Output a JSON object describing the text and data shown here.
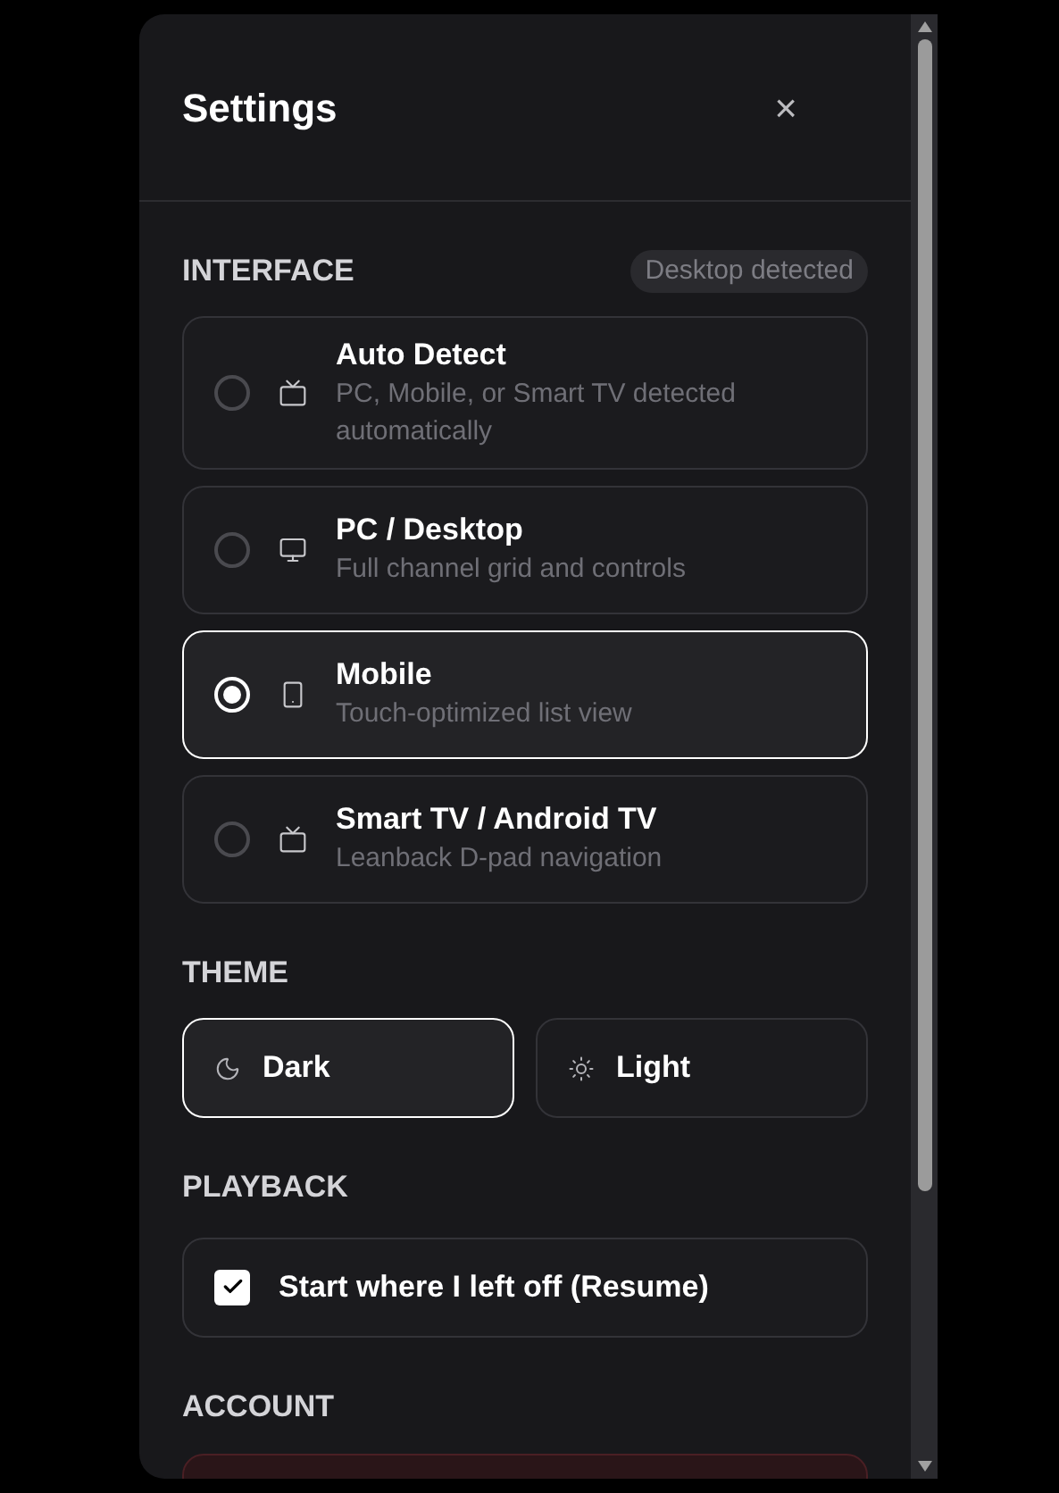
{
  "dialog": {
    "title": "Settings",
    "close": "×"
  },
  "interface": {
    "heading": "INTERFACE",
    "badge": "Desktop detected",
    "options": [
      {
        "kind": "tv",
        "title": "Auto Detect",
        "description": "PC, Mobile, or Smart TV detected automatically",
        "selected": false
      },
      {
        "kind": "monitor",
        "title": "PC / Desktop",
        "description": "Full channel grid and controls",
        "selected": false
      },
      {
        "kind": "phone",
        "title": "Mobile",
        "description": "Touch-optimized list view",
        "selected": true
      },
      {
        "kind": "tv",
        "title": "Smart TV / Android TV",
        "description": "Leanback D-pad navigation",
        "selected": false
      }
    ]
  },
  "theme": {
    "heading": "THEME",
    "options": [
      {
        "kind": "moon",
        "label": "Dark",
        "selected": true
      },
      {
        "kind": "sun",
        "label": "Light",
        "selected": false
      }
    ]
  },
  "playback": {
    "heading": "PLAYBACK",
    "resume": {
      "label": "Start where I left off (Resume)",
      "checked": true
    }
  },
  "account": {
    "heading": "ACCOUNT"
  }
}
